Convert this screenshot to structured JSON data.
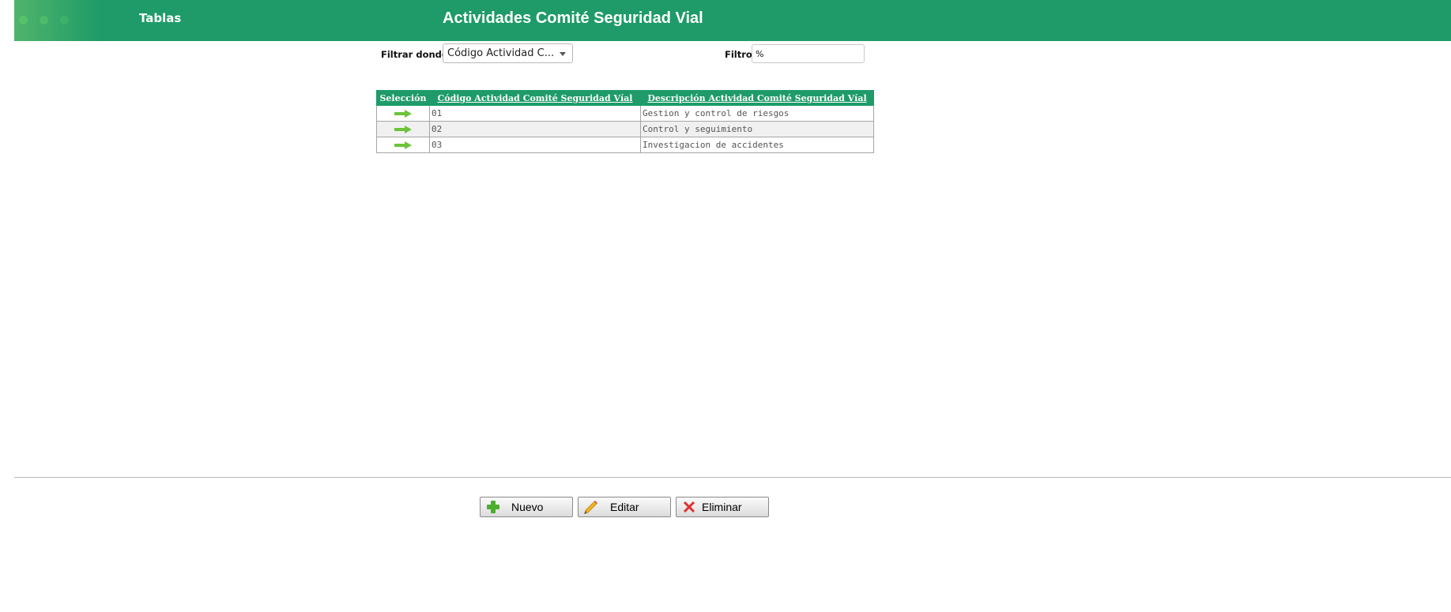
{
  "header": {
    "tab_label": "Tablas",
    "title": "Actividades Comité Seguridad Vial",
    "color": "#1e9b68"
  },
  "filter": {
    "field_label": "Filtrar donde",
    "field_value": "Código Actividad C...",
    "text_label": "Filtro",
    "text_value": "%"
  },
  "table": {
    "columns": [
      "Selección",
      "Código Actividad Comité Seguridad Víal",
      "Descripción Actividad Comité Seguridad Víal"
    ],
    "rows": [
      {
        "selector_icon": "arrow-right-icon",
        "code": "01",
        "description": "Gestion y control de riesgos"
      },
      {
        "selector_icon": "arrow-right-icon",
        "code": "02",
        "description": "Control y seguimiento"
      },
      {
        "selector_icon": "arrow-right-icon",
        "code": "03",
        "description": "Investigacion de accidentes"
      }
    ]
  },
  "buttons": {
    "new": {
      "label": "Nuevo",
      "icon": "plus-icon"
    },
    "edit": {
      "label": "Editar",
      "icon": "pencil-icon"
    },
    "delete": {
      "label": "Eliminar",
      "icon": "x-icon"
    }
  }
}
